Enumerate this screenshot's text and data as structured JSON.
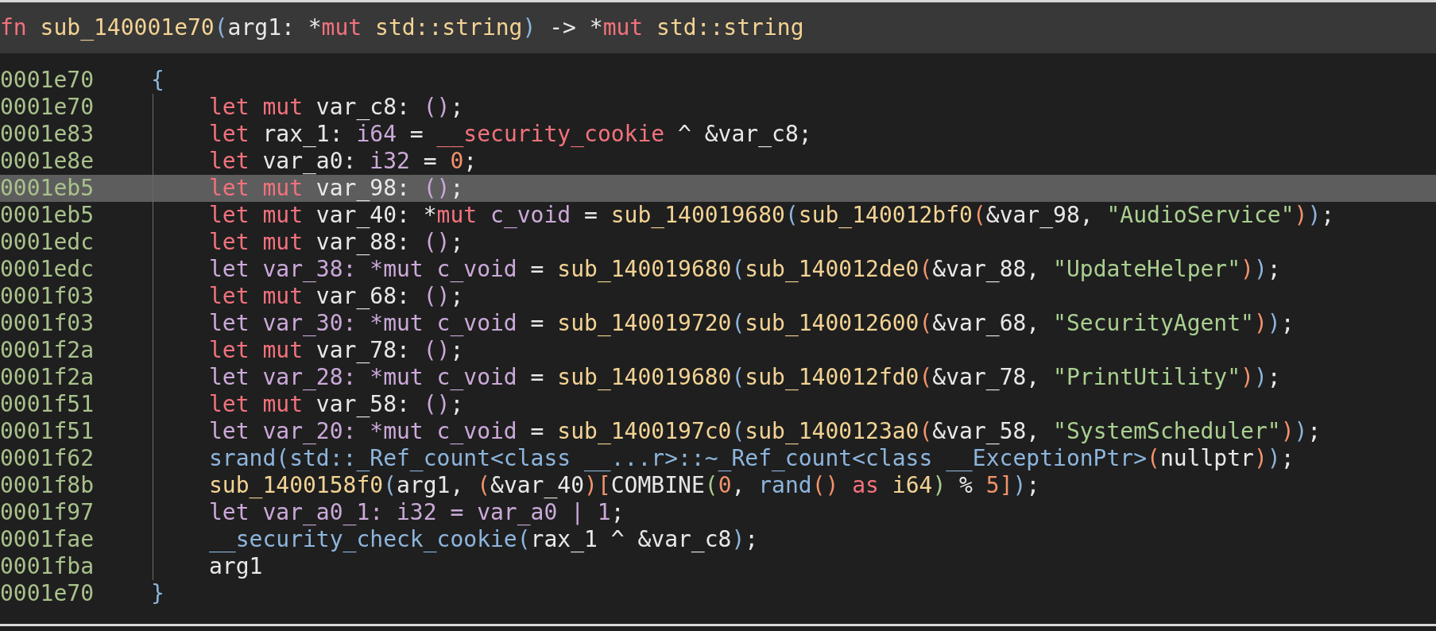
{
  "signature": [
    {
      "text": "fn ",
      "kind": "keyword"
    },
    {
      "text": "sub_140001e70",
      "kind": "function"
    },
    {
      "text": "(",
      "kind": "delim"
    },
    {
      "text": "arg1: *",
      "kind": "plain"
    },
    {
      "text": "mut",
      "kind": "keyword"
    },
    {
      "text": " std::string",
      "kind": "function"
    },
    {
      "text": ")",
      "kind": "delim"
    },
    {
      "text": " -> *",
      "kind": "plain"
    },
    {
      "text": "mut",
      "kind": "keyword"
    },
    {
      "text": " std::string",
      "kind": "function"
    }
  ],
  "lines": [
    {
      "address": "0001e70",
      "selected": false,
      "tokens": [
        {
          "text": "{",
          "kind": "delim"
        }
      ],
      "children": [
        {
          "address": "0001e70",
          "selected": false,
          "tokens": [
            {
              "text": "let mut",
              "kind": "keyword"
            },
            {
              "text": " var_c8: ",
              "kind": "plain"
            },
            {
              "text": "()",
              "kind": "type"
            },
            {
              "text": ";",
              "kind": "plain"
            }
          ]
        },
        {
          "address": "0001e83",
          "selected": false,
          "tokens": [
            {
              "text": "let",
              "kind": "keyword"
            },
            {
              "text": " rax_1: ",
              "kind": "plain"
            },
            {
              "text": "i64",
              "kind": "type"
            },
            {
              "text": " = ",
              "kind": "plain"
            },
            {
              "text": "__security_cookie",
              "kind": "keyword"
            },
            {
              "text": " ^ &var_c8;",
              "kind": "plain"
            }
          ]
        },
        {
          "address": "0001e8e",
          "selected": false,
          "tokens": [
            {
              "text": "let",
              "kind": "keyword"
            },
            {
              "text": " var_a0: ",
              "kind": "plain"
            },
            {
              "text": "i32",
              "kind": "type"
            },
            {
              "text": " = ",
              "kind": "plain"
            },
            {
              "text": "0",
              "kind": "number"
            },
            {
              "text": ";",
              "kind": "plain"
            }
          ]
        },
        {
          "address": "0001eb5",
          "selected": true,
          "tokens": [
            {
              "text": "let mut",
              "kind": "keyword"
            },
            {
              "text": " var_98: ",
              "kind": "plain"
            },
            {
              "text": "()",
              "kind": "type"
            },
            {
              "text": ";",
              "kind": "plain"
            }
          ]
        },
        {
          "address": "0001eb5",
          "selected": false,
          "tokens": [
            {
              "text": "let mut",
              "kind": "keyword"
            },
            {
              "text": " var_40: *",
              "kind": "plain"
            },
            {
              "text": "mut",
              "kind": "keyword"
            },
            {
              "text": " c_void",
              "kind": "type"
            },
            {
              "text": " = ",
              "kind": "plain"
            },
            {
              "text": "sub_140019680",
              "kind": "function"
            },
            {
              "text": "(",
              "kind": "delim"
            },
            {
              "text": "sub_140012bf0",
              "kind": "function"
            },
            {
              "text": "(",
              "kind": "bracket"
            },
            {
              "text": "&var_98, ",
              "kind": "plain"
            },
            {
              "text": "\"AudioService\"",
              "kind": "string"
            },
            {
              "text": ")",
              "kind": "bracket"
            },
            {
              "text": ")",
              "kind": "delim"
            },
            {
              "text": ";",
              "kind": "plain"
            }
          ]
        },
        {
          "address": "0001edc",
          "selected": false,
          "tokens": [
            {
              "text": "let mut",
              "kind": "keyword"
            },
            {
              "text": " var_88: ",
              "kind": "plain"
            },
            {
              "text": "()",
              "kind": "type"
            },
            {
              "text": ";",
              "kind": "plain"
            }
          ]
        },
        {
          "address": "0001edc",
          "selected": false,
          "tokens": [
            {
              "text": "let var_38: *mut c_void",
              "kind": "type"
            },
            {
              "text": " = ",
              "kind": "plain"
            },
            {
              "text": "sub_140019680",
              "kind": "function"
            },
            {
              "text": "(",
              "kind": "delim"
            },
            {
              "text": "sub_140012de0",
              "kind": "function"
            },
            {
              "text": "(",
              "kind": "bracket"
            },
            {
              "text": "&var_88, ",
              "kind": "plain"
            },
            {
              "text": "\"UpdateHelper\"",
              "kind": "string"
            },
            {
              "text": ")",
              "kind": "bracket"
            },
            {
              "text": ")",
              "kind": "delim"
            },
            {
              "text": ";",
              "kind": "plain"
            }
          ]
        },
        {
          "address": "0001f03",
          "selected": false,
          "tokens": [
            {
              "text": "let mut",
              "kind": "keyword"
            },
            {
              "text": " var_68: ",
              "kind": "plain"
            },
            {
              "text": "()",
              "kind": "type"
            },
            {
              "text": ";",
              "kind": "plain"
            }
          ]
        },
        {
          "address": "0001f03",
          "selected": false,
          "tokens": [
            {
              "text": "let var_30: *mut c_void",
              "kind": "type"
            },
            {
              "text": " = ",
              "kind": "plain"
            },
            {
              "text": "sub_140019720",
              "kind": "function"
            },
            {
              "text": "(",
              "kind": "delim"
            },
            {
              "text": "sub_140012600",
              "kind": "function"
            },
            {
              "text": "(",
              "kind": "bracket"
            },
            {
              "text": "&var_68, ",
              "kind": "plain"
            },
            {
              "text": "\"SecurityAgent\"",
              "kind": "string"
            },
            {
              "text": ")",
              "kind": "bracket"
            },
            {
              "text": ")",
              "kind": "delim"
            },
            {
              "text": ";",
              "kind": "plain"
            }
          ]
        },
        {
          "address": "0001f2a",
          "selected": false,
          "tokens": [
            {
              "text": "let mut",
              "kind": "keyword"
            },
            {
              "text": " var_78: ",
              "kind": "plain"
            },
            {
              "text": "()",
              "kind": "type"
            },
            {
              "text": ";",
              "kind": "plain"
            }
          ]
        },
        {
          "address": "0001f2a",
          "selected": false,
          "tokens": [
            {
              "text": "let var_28: *mut c_void",
              "kind": "type"
            },
            {
              "text": " = ",
              "kind": "plain"
            },
            {
              "text": "sub_140019680",
              "kind": "function"
            },
            {
              "text": "(",
              "kind": "delim"
            },
            {
              "text": "sub_140012fd0",
              "kind": "function"
            },
            {
              "text": "(",
              "kind": "bracket"
            },
            {
              "text": "&var_78, ",
              "kind": "plain"
            },
            {
              "text": "\"PrintUtility\"",
              "kind": "string"
            },
            {
              "text": ")",
              "kind": "bracket"
            },
            {
              "text": ")",
              "kind": "delim"
            },
            {
              "text": ";",
              "kind": "plain"
            }
          ]
        },
        {
          "address": "0001f51",
          "selected": false,
          "tokens": [
            {
              "text": "let mut",
              "kind": "keyword"
            },
            {
              "text": " var_58: ",
              "kind": "plain"
            },
            {
              "text": "()",
              "kind": "type"
            },
            {
              "text": ";",
              "kind": "plain"
            }
          ]
        },
        {
          "address": "0001f51",
          "selected": false,
          "tokens": [
            {
              "text": "let var_20: *mut c_void",
              "kind": "type"
            },
            {
              "text": " = ",
              "kind": "plain"
            },
            {
              "text": "sub_1400197c0",
              "kind": "function"
            },
            {
              "text": "(",
              "kind": "delim"
            },
            {
              "text": "sub_1400123a0",
              "kind": "function"
            },
            {
              "text": "(",
              "kind": "bracket"
            },
            {
              "text": "&var_58, ",
              "kind": "plain"
            },
            {
              "text": "\"SystemScheduler\"",
              "kind": "string"
            },
            {
              "text": ")",
              "kind": "bracket"
            },
            {
              "text": ")",
              "kind": "delim"
            },
            {
              "text": ";",
              "kind": "plain"
            }
          ]
        },
        {
          "address": "0001f62",
          "selected": false,
          "tokens": [
            {
              "text": "srand(std::_Ref_count<class __...r>::~_Ref_count<class __ExceptionPtr>",
              "kind": "delim"
            },
            {
              "text": "(",
              "kind": "bracket"
            },
            {
              "text": "nullptr",
              "kind": "plain"
            },
            {
              "text": ")",
              "kind": "bracket"
            },
            {
              "text": ")",
              "kind": "delim"
            },
            {
              "text": ";",
              "kind": "plain"
            }
          ]
        },
        {
          "address": "0001f8b",
          "selected": false,
          "tokens": [
            {
              "text": "sub_1400158f0",
              "kind": "function"
            },
            {
              "text": "(",
              "kind": "delim"
            },
            {
              "text": "arg1, ",
              "kind": "plain"
            },
            {
              "text": "(",
              "kind": "bracket"
            },
            {
              "text": "&var_40",
              "kind": "plain"
            },
            {
              "text": ")[",
              "kind": "bracket"
            },
            {
              "text": "COMBINE",
              "kind": "plain"
            },
            {
              "text": "(",
              "kind": "string"
            },
            {
              "text": "0",
              "kind": "number"
            },
            {
              "text": ", ",
              "kind": "plain"
            },
            {
              "text": "rand",
              "kind": "delim"
            },
            {
              "text": "()",
              "kind": "bracket"
            },
            {
              "text": " as ",
              "kind": "keyword"
            },
            {
              "text": "i64",
              "kind": "function"
            },
            {
              "text": ")",
              "kind": "string"
            },
            {
              "text": " % ",
              "kind": "plain"
            },
            {
              "text": "5",
              "kind": "number"
            },
            {
              "text": "]",
              "kind": "bracket"
            },
            {
              "text": ")",
              "kind": "delim"
            },
            {
              "text": ";",
              "kind": "plain"
            }
          ]
        },
        {
          "address": "0001f97",
          "selected": false,
          "tokens": [
            {
              "text": "let var_a0_1: i32 = var_a0 | 1",
              "kind": "type"
            },
            {
              "text": ";",
              "kind": "plain"
            }
          ]
        },
        {
          "address": "0001fae",
          "selected": false,
          "tokens": [
            {
              "text": "__security_check_cookie(",
              "kind": "delim"
            },
            {
              "text": "rax_1 ^ &var_c8",
              "kind": "plain"
            },
            {
              "text": ")",
              "kind": "delim"
            },
            {
              "text": ";",
              "kind": "plain"
            }
          ]
        },
        {
          "address": "0001fba",
          "selected": false,
          "tokens": [
            {
              "text": "arg1",
              "kind": "plain"
            }
          ]
        }
      ]
    },
    {
      "address": "0001e70",
      "selected": false,
      "tokens": [
        {
          "text": "}",
          "kind": "delim"
        }
      ]
    }
  ]
}
